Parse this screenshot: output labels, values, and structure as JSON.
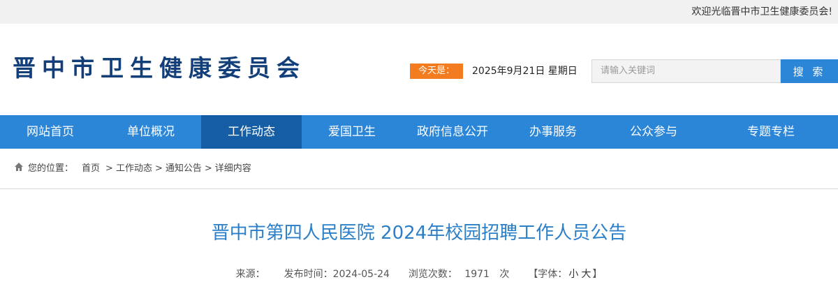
{
  "topbar": {
    "welcome": "欢迎光临晋中市卫生健康委员会!"
  },
  "header": {
    "site_title": "晋中市卫生健康委员会",
    "today_label": "今天是：",
    "date_text": "2025年9月21日 星期日"
  },
  "search": {
    "placeholder": "请输入关键词",
    "button_label": "搜 索"
  },
  "nav": {
    "items": [
      {
        "label": "网站首页"
      },
      {
        "label": "单位概况"
      },
      {
        "label": "工作动态"
      },
      {
        "label": "爱国卫生"
      },
      {
        "label": "政府信息公开"
      },
      {
        "label": "办事服务"
      },
      {
        "label": "公众参与"
      },
      {
        "label": "专题专栏"
      }
    ],
    "active_index": 2
  },
  "breadcrumb": {
    "prefix": "您的位置：",
    "items": [
      "首页",
      "工作动态",
      "通知公告",
      "详细内容"
    ],
    "separator": ">"
  },
  "article": {
    "title": "晋中市第四人民医院 2024年校园招聘工作人员公告",
    "meta": {
      "source_label": "来源：",
      "publish_label": "发布时间：",
      "publish_date": "2024-05-24",
      "views_label": "浏览次数：",
      "views_count": "1971",
      "views_unit": "次",
      "font_label": "【字体：",
      "font_small": "小",
      "font_large": "大",
      "font_close": "】"
    }
  },
  "colors": {
    "title_blue": "#123f7a",
    "nav_blue": "#2b86d8",
    "nav_active": "#155ea6",
    "orange": "#f47c20",
    "article_title": "#2b7fc9"
  }
}
